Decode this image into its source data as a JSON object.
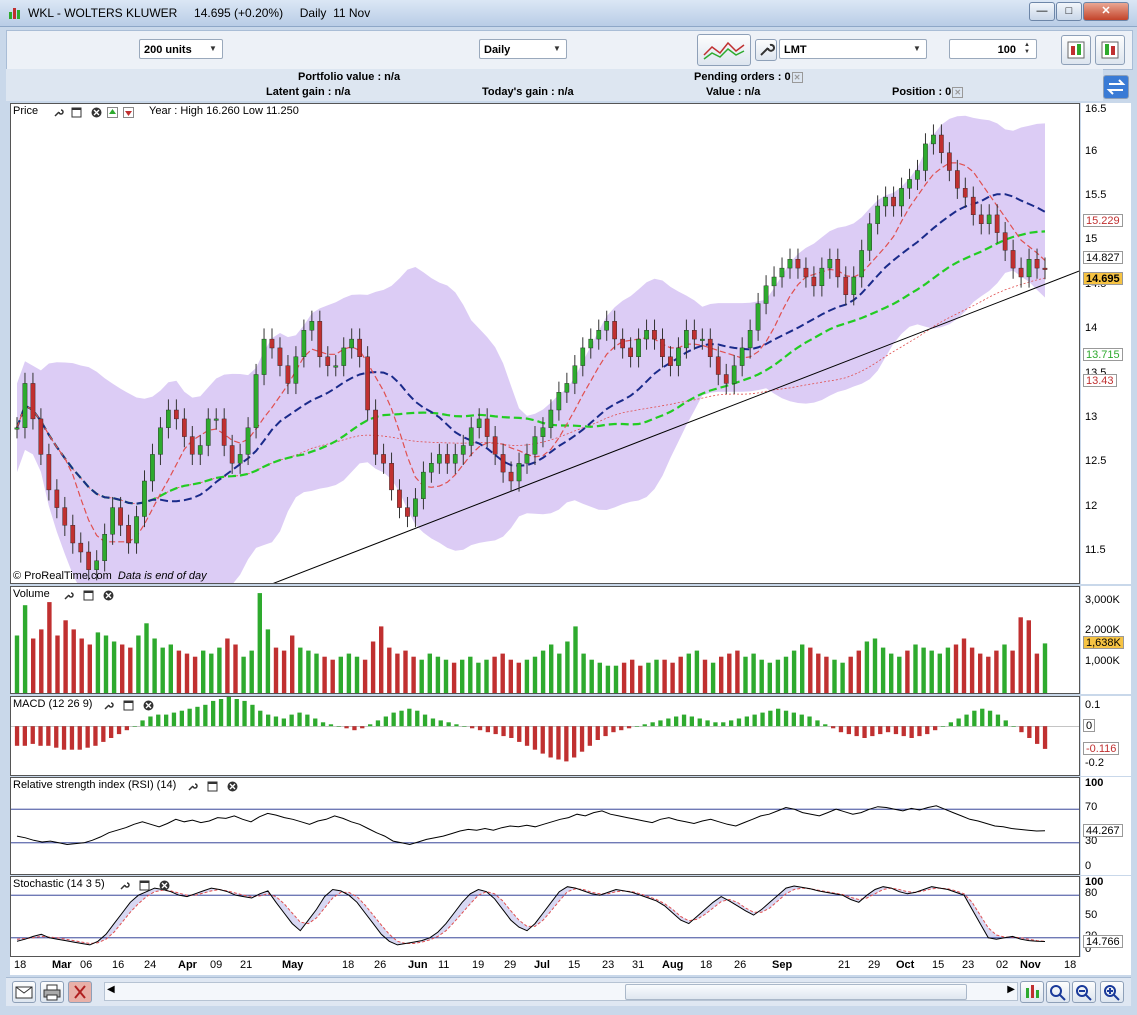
{
  "window": {
    "title": "WKL - WOLTERS KLUWER     14.695 (+0.20%)     Daily  11 Nov"
  },
  "toolbar": {
    "units": "200 units",
    "period": "Daily",
    "order_type": "LMT",
    "quantity": "100"
  },
  "info": {
    "portfolio_value": "Portfolio value : n/a",
    "latent_gain": "Latent gain : n/a",
    "todays_gain": "Today's gain : n/a",
    "pending_orders": "Pending orders : 0",
    "value": "Value : n/a",
    "position": "Position : 0"
  },
  "panels": {
    "price": {
      "label": "Price",
      "year_range": "Year : High 16.260 Low 11.250",
      "credit": "© ProRealTime.com",
      "credit_note": "Data is end of day"
    },
    "volume": {
      "label": "Volume"
    },
    "macd": {
      "label": "MACD (12 26 9)"
    },
    "rsi": {
      "label": "Relative strength index (RSI) (14)"
    },
    "stochastic": {
      "label": "Stochastic (14 3 5)"
    }
  },
  "colors": {
    "up": "#2eaa2e",
    "down": "#c03030",
    "bollinger": "#dcccf5",
    "ma_short": "#e05050",
    "ma_mid": "#1a2a8a",
    "ma_long": "#22cc22"
  },
  "chart_data": [
    {
      "type": "candlestick",
      "name": "Price",
      "ylim": [
        11.15,
        16.55
      ],
      "y_ticks": [
        "16.5",
        "16",
        "15.5",
        "15",
        "14.5",
        "14",
        "13.5",
        "13",
        "12.5",
        "12",
        "11.5"
      ],
      "value_tags": [
        "15.229",
        "14.827",
        "14.695",
        "13.715",
        "13.43"
      ],
      "last": 14.695,
      "year_high": 16.26,
      "year_low": 11.25,
      "series": [
        {
          "name": "close",
          "values": [
            12.9,
            13.4,
            13.0,
            12.6,
            12.2,
            12.0,
            11.8,
            11.6,
            11.5,
            11.3,
            11.4,
            11.7,
            12.0,
            11.8,
            11.6,
            11.9,
            12.3,
            12.6,
            12.9,
            13.1,
            13.0,
            12.8,
            12.6,
            12.7,
            13.0,
            13.0,
            12.7,
            12.5,
            12.6,
            12.9,
            13.5,
            13.9,
            13.8,
            13.6,
            13.4,
            13.7,
            14.0,
            14.1,
            13.7,
            13.6,
            13.6,
            13.8,
            13.9,
            13.7,
            13.1,
            12.6,
            12.5,
            12.2,
            12.0,
            11.9,
            12.1,
            12.4,
            12.5,
            12.6,
            12.5,
            12.6,
            12.7,
            12.9,
            13.0,
            12.8,
            12.6,
            12.4,
            12.3,
            12.5,
            12.6,
            12.8,
            12.9,
            13.1,
            13.3,
            13.4,
            13.6,
            13.8,
            13.9,
            14.0,
            14.1,
            13.9,
            13.8,
            13.7,
            13.9,
            14.0,
            13.9,
            13.7,
            13.6,
            13.8,
            14.0,
            13.9,
            13.9,
            13.7,
            13.5,
            13.4,
            13.6,
            13.8,
            14.0,
            14.3,
            14.5,
            14.6,
            14.7,
            14.8,
            14.7,
            14.6,
            14.5,
            14.7,
            14.8,
            14.6,
            14.4,
            14.6,
            14.9,
            15.2,
            15.4,
            15.5,
            15.4,
            15.6,
            15.7,
            15.8,
            16.1,
            16.2,
            16.0,
            15.8,
            15.6,
            15.5,
            15.3,
            15.2,
            15.3,
            15.1,
            14.9,
            14.7,
            14.6,
            14.8,
            14.7,
            14.695
          ]
        }
      ],
      "overlays": [
        "Bollinger bands",
        "Moving average (short)",
        "Moving average (mid)",
        "Moving average (long)",
        "Trend line"
      ]
    },
    {
      "type": "bar",
      "name": "Volume",
      "ylim": [
        0,
        3500000
      ],
      "y_ticks": [
        "3,000K",
        "2,000K",
        "1,000K"
      ],
      "value_tags": [
        "1,638K"
      ],
      "values": [
        1900,
        2900,
        1800,
        2100,
        3000,
        1900,
        2400,
        2100,
        1800,
        1600,
        2000,
        1900,
        1700,
        1600,
        1500,
        1900,
        2300,
        1800,
        1500,
        1600,
        1400,
        1300,
        1200,
        1400,
        1300,
        1500,
        1800,
        1600,
        1200,
        1400,
        3300,
        2100,
        1500,
        1400,
        1900,
        1500,
        1400,
        1300,
        1200,
        1100,
        1200,
        1300,
        1200,
        1100,
        1700,
        2200,
        1500,
        1300,
        1400,
        1200,
        1100,
        1300,
        1200,
        1100,
        1000,
        1100,
        1200,
        1000,
        1100,
        1200,
        1300,
        1100,
        1000,
        1100,
        1200,
        1400,
        1600,
        1300,
        1700,
        2200,
        1300,
        1100,
        1000,
        900,
        900,
        1000,
        1100,
        900,
        1000,
        1100,
        1100,
        1000,
        1200,
        1300,
        1400,
        1100,
        1000,
        1200,
        1300,
        1400,
        1200,
        1300,
        1100,
        1000,
        1100,
        1200,
        1400,
        1600,
        1500,
        1300,
        1200,
        1100,
        1000,
        1200,
        1400,
        1700,
        1800,
        1500,
        1300,
        1200,
        1400,
        1600,
        1500,
        1400,
        1300,
        1500,
        1600,
        1800,
        1500,
        1300,
        1200,
        1400,
        1600,
        1400,
        2500,
        2400,
        1300,
        1638
      ]
    },
    {
      "type": "bar",
      "name": "MACD (12 26 9)",
      "ylim": [
        -0.25,
        0.15
      ],
      "y_ticks": [
        "0.1",
        "0",
        "-0.2"
      ],
      "value_tags": [
        "0",
        "-0.116"
      ],
      "values": [
        -0.1,
        -0.1,
        -0.09,
        -0.1,
        -0.1,
        -0.11,
        -0.12,
        -0.12,
        -0.12,
        -0.11,
        -0.1,
        -0.08,
        -0.06,
        -0.04,
        -0.02,
        0.0,
        0.03,
        0.05,
        0.06,
        0.06,
        0.07,
        0.08,
        0.09,
        0.1,
        0.11,
        0.13,
        0.14,
        0.15,
        0.14,
        0.13,
        0.11,
        0.08,
        0.06,
        0.05,
        0.04,
        0.06,
        0.07,
        0.06,
        0.04,
        0.02,
        0.01,
        0.0,
        -0.01,
        -0.02,
        -0.01,
        0.01,
        0.03,
        0.05,
        0.07,
        0.08,
        0.09,
        0.08,
        0.06,
        0.04,
        0.03,
        0.02,
        0.01,
        0.0,
        -0.01,
        -0.02,
        -0.03,
        -0.04,
        -0.05,
        -0.06,
        -0.08,
        -0.1,
        -0.12,
        -0.14,
        -0.16,
        -0.17,
        -0.18,
        -0.16,
        -0.13,
        -0.1,
        -0.07,
        -0.05,
        -0.03,
        -0.02,
        -0.01,
        0.0,
        0.01,
        0.02,
        0.03,
        0.04,
        0.05,
        0.06,
        0.05,
        0.04,
        0.03,
        0.02,
        0.02,
        0.03,
        0.04,
        0.05,
        0.06,
        0.07,
        0.08,
        0.09,
        0.08,
        0.07,
        0.06,
        0.05,
        0.03,
        0.01,
        -0.01,
        -0.03,
        -0.04,
        -0.05,
        -0.06,
        -0.05,
        -0.04,
        -0.03,
        -0.04,
        -0.05,
        -0.06,
        -0.05,
        -0.04,
        -0.02,
        0.0,
        0.02,
        0.04,
        0.06,
        0.08,
        0.09,
        0.08,
        0.06,
        0.03,
        0.0,
        -0.03,
        -0.06,
        -0.09,
        -0.116
      ]
    },
    {
      "type": "line",
      "name": "Relative strength index (RSI) (14)",
      "ylim": [
        0,
        100
      ],
      "y_ticks": [
        "100",
        "70",
        "30",
        "0"
      ],
      "value_tags": [
        "44.267"
      ],
      "values": [
        38,
        36,
        33,
        31,
        32,
        30,
        28,
        29,
        30,
        33,
        37,
        42,
        45,
        48,
        52,
        55,
        52,
        49,
        53,
        58,
        55,
        57,
        54,
        56,
        60,
        59,
        62,
        58,
        55,
        61,
        65,
        63,
        60,
        58,
        55,
        52,
        56,
        58,
        62,
        59,
        55,
        52,
        47,
        42,
        38,
        32,
        30,
        28,
        31,
        34,
        36,
        38,
        41,
        44,
        46,
        45,
        47,
        45,
        48,
        50,
        49,
        51,
        49,
        52,
        55,
        58,
        60,
        64,
        62,
        66,
        68,
        64,
        62,
        60,
        58,
        56,
        54,
        58,
        60,
        57,
        55,
        53,
        56,
        58,
        55,
        52,
        50,
        54,
        58,
        62,
        64,
        68,
        72,
        70,
        66,
        64,
        62,
        66,
        70,
        67,
        64,
        66,
        70,
        73,
        72,
        70,
        68,
        71,
        69,
        72,
        74,
        70,
        66,
        62,
        58,
        56,
        53,
        50,
        49,
        47,
        46,
        45,
        44,
        44.267
      ]
    },
    {
      "type": "line",
      "name": "Stochastic (14 3 5)",
      "ylim": [
        0,
        100
      ],
      "y_ticks": [
        "100",
        "80",
        "50",
        "20",
        "0"
      ],
      "value_tags": [
        "14.766"
      ],
      "series": [
        {
          "name": "%K",
          "values": [
            15,
            18,
            22,
            25,
            20,
            18,
            16,
            14,
            12,
            10,
            15,
            25,
            40,
            55,
            70,
            80,
            85,
            90,
            88,
            85,
            80,
            78,
            82,
            86,
            90,
            88,
            85,
            80,
            78,
            76,
            82,
            86,
            70,
            55,
            40,
            30,
            45,
            60,
            78,
            88,
            86,
            80,
            70,
            55,
            40,
            25,
            15,
            10,
            12,
            14,
            16,
            20,
            28,
            40,
            55,
            70,
            82,
            88,
            85,
            75,
            60,
            45,
            35,
            30,
            40,
            55,
            70,
            85,
            92,
            90,
            86,
            82,
            80,
            84,
            88,
            86,
            84,
            80,
            76,
            72,
            65,
            55,
            45,
            40,
            50,
            60,
            70,
            78,
            72,
            65,
            58,
            52,
            60,
            70,
            80,
            90,
            93,
            91,
            89,
            86,
            84,
            82,
            80,
            74,
            70,
            80,
            88,
            92,
            90,
            85,
            82,
            84,
            88,
            92,
            90,
            88,
            84,
            80,
            60,
            40,
            20,
            18,
            20,
            22,
            18,
            16,
            15,
            14.766
          ]
        },
        {
          "name": "%D",
          "values": [
            18,
            19,
            20,
            22,
            21,
            20,
            18,
            16,
            14,
            12,
            13,
            18,
            28,
            42,
            56,
            68,
            78,
            85,
            87,
            86,
            83,
            80,
            80,
            83,
            86,
            88,
            86,
            83,
            80,
            78,
            79,
            82,
            78,
            68,
            55,
            42,
            40,
            48,
            62,
            76,
            84,
            84,
            78,
            66,
            52,
            38,
            25,
            15,
            12,
            12,
            14,
            17,
            22,
            30,
            42,
            55,
            68,
            80,
            85,
            82,
            72,
            58,
            45,
            36,
            36,
            45,
            58,
            72,
            85,
            89,
            88,
            84,
            82,
            82,
            85,
            86,
            85,
            82,
            78,
            74,
            68,
            60,
            50,
            44,
            46,
            53,
            62,
            71,
            74,
            70,
            62,
            56,
            56,
            62,
            72,
            82,
            88,
            90,
            89,
            87,
            85,
            83,
            81,
            77,
            74,
            76,
            82,
            88,
            90,
            88,
            85,
            84,
            86,
            89,
            90,
            89,
            86,
            82,
            70,
            52,
            34,
            24,
            21,
            21,
            20,
            18,
            16,
            15
          ]
        }
      ]
    }
  ],
  "x_axis": {
    "labels": [
      "18",
      "Mar",
      "06",
      "16",
      "24",
      "Apr",
      "09",
      "21",
      "May",
      "18",
      "26",
      "Jun",
      "11",
      "19",
      "29",
      "Jul",
      "15",
      "23",
      "31",
      "Aug",
      "18",
      "26",
      "Sep",
      "21",
      "29",
      "Oct",
      "15",
      "23",
      "02",
      "Nov",
      "18"
    ]
  }
}
